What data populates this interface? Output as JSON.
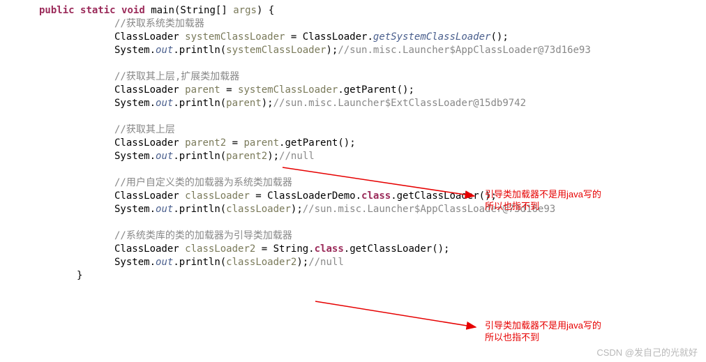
{
  "colors": {
    "keyword": "#9b2b5a",
    "field_italic": "#4a5f8d",
    "comment": "#888888",
    "annotation": "#e60000",
    "watermark": "#b8b8b8"
  },
  "code": {
    "sig": {
      "public": "public",
      "static": "static",
      "void": "void",
      "main": "main",
      "paren_open": "(",
      "String": "String",
      "brackets": "[] ",
      "args": "args",
      "paren_close_brace": ") {"
    },
    "c1": "//获取系统类加载器",
    "l1a": "ClassLoader ",
    "l1b": "systemClassLoader",
    "l1c": " = ClassLoader.",
    "l1d": "getSystemClassLoader",
    "l1e": "();",
    "l2a": "System.",
    "l2b": "out",
    "l2c": ".println(",
    "l2d": "systemClassLoader",
    "l2e": ");",
    "l2f": "//sun.misc.Launcher$AppClassLoader@73d16e93",
    "c2": "//获取其上层,扩展类加载器",
    "l3a": "ClassLoader ",
    "l3b": "parent",
    "l3c": " = ",
    "l3d": "systemClassLoader",
    "l3e": ".getParent();",
    "l4a": "System.",
    "l4b": "out",
    "l4c": ".println(",
    "l4d": "parent",
    "l4e": ");",
    "l4f": "//sun.misc.Launcher$ExtClassLoader@15db9742",
    "c3": "//获取其上层",
    "l5a": "ClassLoader ",
    "l5b": "parent2",
    "l5c": " = ",
    "l5d": "parent",
    "l5e": ".getParent();",
    "l6a": "System.",
    "l6b": "out",
    "l6c": ".println(",
    "l6d": "parent2",
    "l6e": ");",
    "l6f": "//null",
    "c4": "//用户自定义类的加载器为系统类加载器",
    "l7a": "ClassLoader ",
    "l7b": "classLoader",
    "l7c": " = ClassLoaderDemo.",
    "l7d": "class",
    "l7e": ".getClassLoader();",
    "l8a": "System.",
    "l8b": "out",
    "l8c": ".println(",
    "l8d": "classLoader",
    "l8e": ");",
    "l8f": "//sun.misc.Launcher$AppClassLoader@73d16e93",
    "c5": "//系统类库的类的加载器为引导类加载器",
    "l9a": "ClassLoader ",
    "l9b": "classLoader2",
    "l9c": " = String.",
    "l9d": "class",
    "l9e": ".getClassLoader();",
    "l10a": "System.",
    "l10b": "out",
    "l10c": ".println(",
    "l10d": "classLoader2",
    "l10e": ");",
    "l10f": "//null",
    "brace_close": "}"
  },
  "annotations": {
    "a1_l1": "引导类加载器不是用java写的",
    "a1_l2": "所以也指不到",
    "a2_l1": "引导类加载器不是用java写的",
    "a2_l2": "所以也指不到"
  },
  "watermark": "CSDN @发自己的光就好"
}
